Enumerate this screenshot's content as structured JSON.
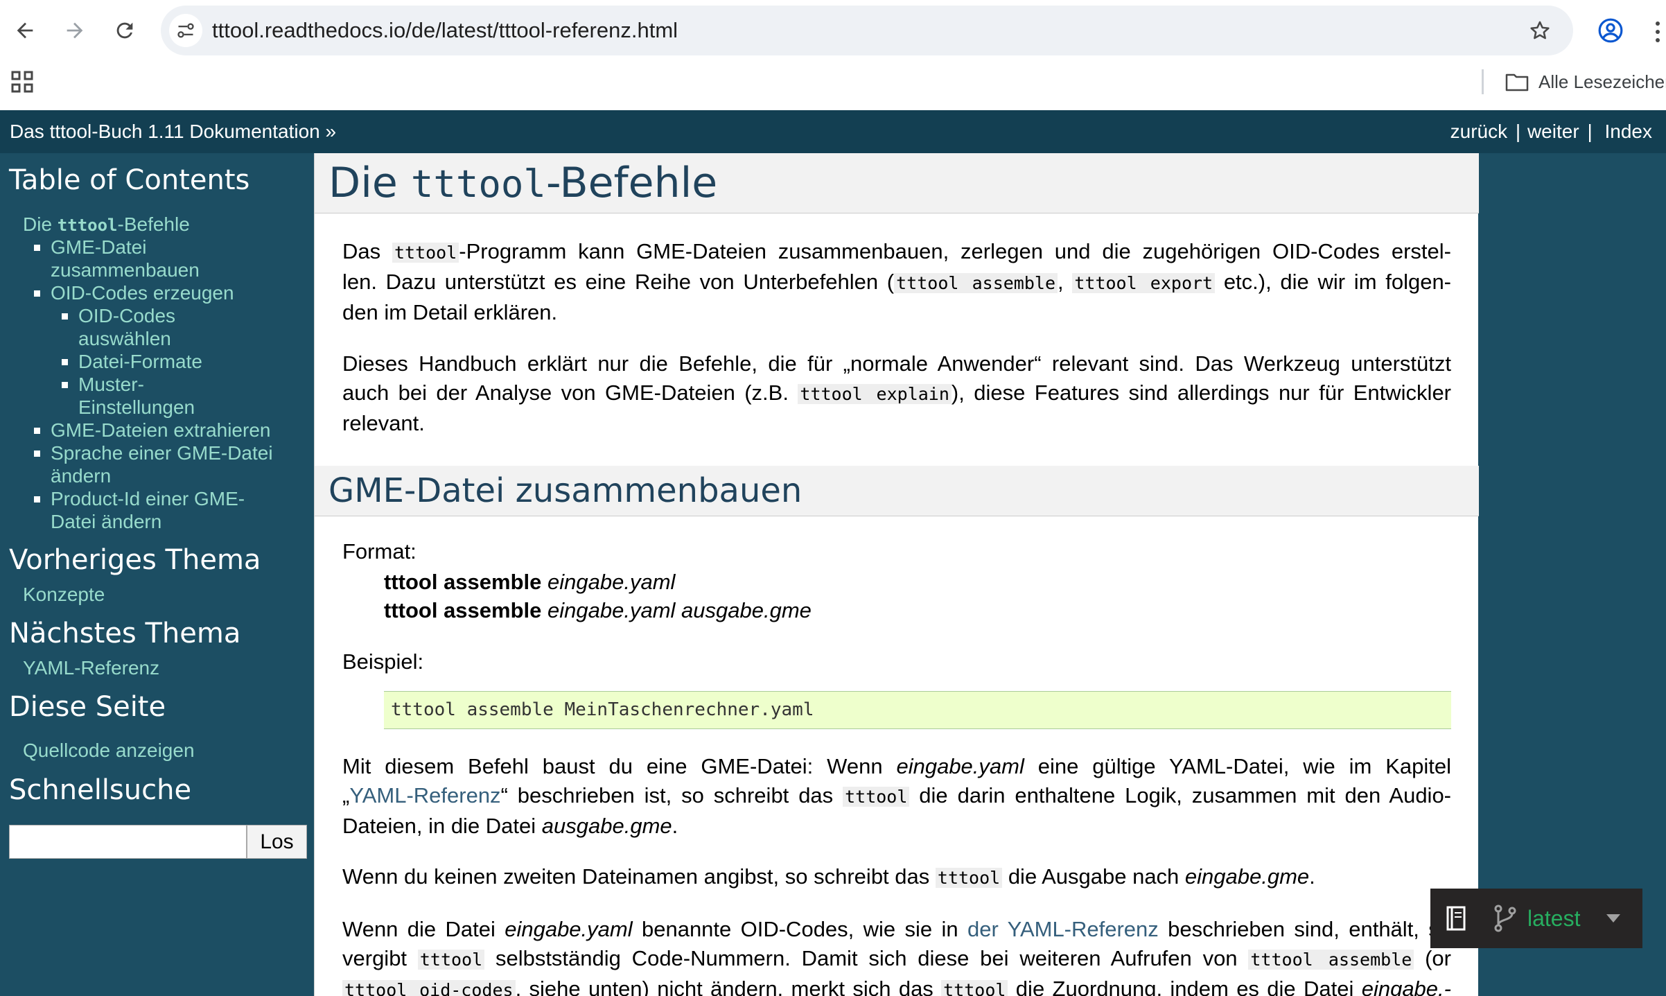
{
  "browser": {
    "url": "tttool.readthedocs.io/de/latest/tttool-referenz.html",
    "bookmarks_label": "Alle Lesezeichen",
    "icons": [
      "back-arrow-icon",
      "forward-arrow-icon",
      "reload-icon",
      "site-settings-icon",
      "star-icon",
      "profile-icon",
      "menu-kebab-icon",
      "apps-grid-icon",
      "folder-icon"
    ]
  },
  "relbar": {
    "doc_title": "Das tttool-Buch 1.11 Dokumentation",
    "raquo": "»",
    "back": "zurück",
    "next": "weiter",
    "index": "Index",
    "sep": "|"
  },
  "sidebar": {
    "toc_heading": "Table of Contents",
    "toc": {
      "root_pre": "Die ",
      "root_code": "tttool",
      "root_post": "-Befehle",
      "item1_l1": "GME-Datei",
      "item1_l2": "zusammenbauen",
      "item2": "OID-Codes erzeugen",
      "sub1_l1": "OID-Codes",
      "sub1_l2": "auswählen",
      "sub2": "Datei-Formate",
      "sub3_l1": "Muster-",
      "sub3_l2": "Einstellungen",
      "item3": "GME-Dateien extrahieren",
      "item4_l1": "Sprache einer GME-Datei",
      "item4_l2": "ändern",
      "item5_l1": "Product-Id einer GME-",
      "item5_l2": "Datei ändern"
    },
    "prev_heading": "Vorheriges Thema",
    "prev_link": "Konzepte",
    "next_heading": "Nächstes Thema",
    "next_link": "YAML-Referenz",
    "page_heading": "Diese Seite",
    "source_link": "Quellcode anzeigen",
    "search_heading": "Schnellsuche",
    "search_value": "",
    "search_button": "Los"
  },
  "main": {
    "h1_pre": "Die ",
    "h1_code": "tttool",
    "h1_post": "-Befehle",
    "p1": {
      "l1_a": "Das ",
      "l1_code": "tttool",
      "l1_b": "-Programm kann GME-Dateien zusammenbauen, zerlegen und die zugehörigen OID-Codes erstel-",
      "l2_a": "len. Dazu unterstützt es eine Reihe von Unterbefehlen (",
      "l2_code1": "tttool assemble",
      "l2_b": ", ",
      "l2_code2": "tttool export",
      "l2_c": " etc.), die wir im folgen-",
      "l3": "den im Detail erklären."
    },
    "p2": {
      "l1": "Dieses Handbuch erklärt nur die Befehle, die für „normale Anwender“ relevant sind. Das Werkzeug unterstützt",
      "l2_a": "auch bei der Analyse von GME-Dateien (z.B. ",
      "l2_code": "tttool explain",
      "l2_b": "), diese Features sind allerdings nur für Entwickler",
      "l3": "relevant."
    },
    "h2": "GME-Datei zusammenbauen",
    "format_label": "Format:",
    "format1_cmd": "tttool assemble",
    "format1_arg": "eingabe.yaml",
    "format2_cmd": "tttool assemble",
    "format2_arg": "eingabe.yaml ausgabe.gme",
    "example_label": "Beispiel:",
    "example_code": "tttool assemble MeinTaschenrechner.yaml",
    "p3": {
      "l1_a": "Mit diesem Befehl baust du eine GME-Datei: Wenn ",
      "l1_i": "eingabe.yaml",
      "l1_b": " eine gültige YAML-Datei, wie im Kapitel",
      "l2_q1": "„",
      "l2_link": "YAML-Referenz",
      "l2_a": "“ beschrieben ist, so schreibt das ",
      "l2_code": "tttool",
      "l2_b": " die darin enthaltene Logik, zusammen mit den Audio-",
      "l3_a": "Dateien, in die Datei ",
      "l3_i": "ausgabe.gme",
      "l3_b": "."
    },
    "p4": {
      "a": "Wenn du keinen zweiten Dateinamen angibst, so schreibt das ",
      "code": "tttool",
      "b": " die Ausgabe nach ",
      "i": "eingabe.gme",
      "c": "."
    },
    "p5": {
      "l1_a": "Wenn die Datei ",
      "l1_i": "eingabe.yaml",
      "l1_b": " benannte OID-Codes, wie sie in ",
      "l1_link": "der YAML-Referenz",
      "l1_c": " beschrieben sind, enthält, so",
      "l2_a": "vergibt ",
      "l2_code1": "tttool",
      "l2_b": " selbstständig Code-Nummern. Damit sich diese bei weiteren Aufrufen von ",
      "l2_code2": "tttool assemble",
      "l2_c": " (or",
      "l3_code1": "tttool oid-codes",
      "l3_a": ", siehe unten) nicht ändern, merkt sich das ",
      "l3_code2": "tttool",
      "l3_b": " die Zuordnung, indem es die Datei ",
      "l3_i": "eingabe.-"
    }
  },
  "rtd_flyout": {
    "version": "latest",
    "icons": [
      "book-icon",
      "branch-icon",
      "caret-down-icon"
    ]
  },
  "colors": {
    "relbar_bg": "#133f52",
    "sidebar_bg": "#1c4e63",
    "sidebar_link": "#98dbcc",
    "heading_text": "#20435c",
    "code_block_bg": "#eeffcc",
    "rtd_bg": "#272525",
    "rtd_version": "#27ae60"
  }
}
